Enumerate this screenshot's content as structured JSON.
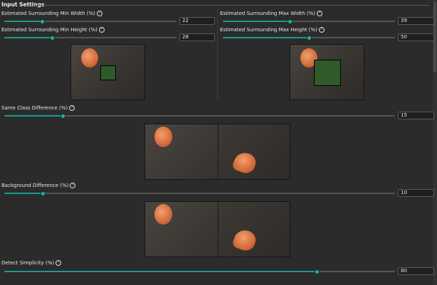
{
  "section": {
    "title": "Input Settings"
  },
  "help_icon": "help-circle-icon",
  "accent_color": "#1db3a4",
  "settings": {
    "min_width": {
      "label": "Estimated Surrounding Min Width (%)",
      "value": "22",
      "fraction": 0.22
    },
    "max_width": {
      "label": "Estimated Surrounding Max Width (%)",
      "value": "39",
      "fraction": 0.39
    },
    "min_height": {
      "label": "Estimated Surrounding Min Height (%)",
      "value": "28",
      "fraction": 0.28
    },
    "max_height": {
      "label": "Estimated Surrounding Max Height (%)",
      "value": "50",
      "fraction": 0.5
    },
    "same_class": {
      "label": "Same Class Difference (%)",
      "value": "15",
      "fraction": 0.15
    },
    "background": {
      "label": "Background Difference (%)",
      "value": "10",
      "fraction": 0.1
    },
    "simplicity": {
      "label": "Detect Simplicity (%)",
      "value": "80",
      "fraction": 0.8
    }
  }
}
